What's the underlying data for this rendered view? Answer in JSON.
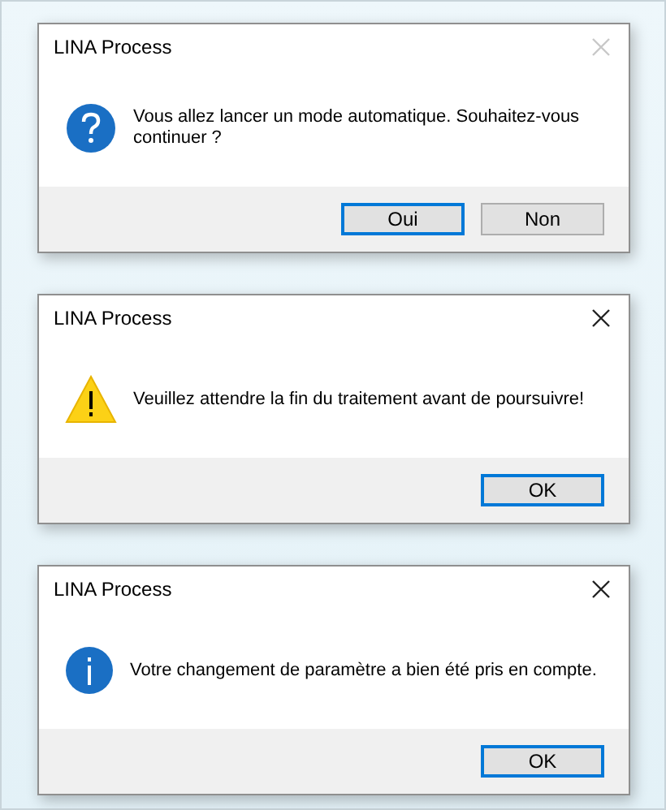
{
  "dialogs": [
    {
      "title": "LINA Process",
      "close_disabled": true,
      "kind": "question",
      "message": "Vous allez lancer un mode automatique. Souhaitez-vous continuer ?",
      "buttons": [
        {
          "label": "Oui",
          "selected": true
        },
        {
          "label": "Non",
          "selected": false
        }
      ]
    },
    {
      "title": "LINA Process",
      "close_disabled": false,
      "kind": "warning",
      "message": "Veuillez attendre la fin du traitement avant de poursuivre!",
      "buttons": [
        {
          "label": "OK",
          "selected": true
        }
      ]
    },
    {
      "title": "LINA Process",
      "close_disabled": false,
      "kind": "info",
      "message": "Votre changement de paramètre a bien été pris en compte.",
      "buttons": [
        {
          "label": "OK",
          "selected": true
        }
      ]
    }
  ]
}
